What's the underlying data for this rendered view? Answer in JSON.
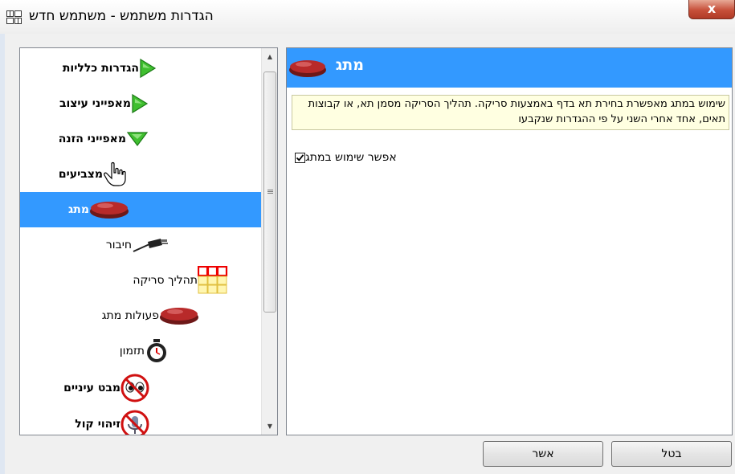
{
  "window": {
    "title": "הגדרות משתמש - משתמש חדש",
    "close_label": "x"
  },
  "nav": {
    "items": [
      {
        "label": "הגדרות כלליות",
        "icon": "green-expand-arrow-icon"
      },
      {
        "label": "מאפייני עיצוב",
        "icon": "green-expand-arrow-icon"
      },
      {
        "label": "מאפייני הזנה",
        "icon": "green-collapse-arrow-icon"
      },
      {
        "label": "מצביעים",
        "icon": "hand-pointer-icon"
      },
      {
        "label": "מתג",
        "icon": "red-switch-button-icon",
        "selected": true
      },
      {
        "label": "חיבור",
        "icon": "cable-plug-icon"
      },
      {
        "label": "תהליך סריקה",
        "icon": "scan-grid-icon"
      },
      {
        "label": "פעולות מתג",
        "icon": "red-switch-button-icon"
      },
      {
        "label": "תזמון",
        "icon": "stopwatch-icon"
      },
      {
        "label": "מבט עיניים",
        "icon": "eyes-disabled-icon"
      },
      {
        "label": "זיהוי קול",
        "icon": "voice-disabled-icon"
      }
    ]
  },
  "content": {
    "header_title": "מתג",
    "description": "שימוש במתג מאפשרת בחירת תא בדף באמצעות סריקה. תהליך הסריקה מסמן תא, או קבוצות תאים, אחד אחרי השני על פי ההגדרות שנקבעו",
    "checkbox_label": "אפשר שימוש במתג",
    "checkbox_checked": true
  },
  "buttons": {
    "ok_label": "אשר",
    "cancel_label": "בטל"
  },
  "colors": {
    "selection": "#3399ff",
    "tooltip_bg": "#ffffe1"
  }
}
